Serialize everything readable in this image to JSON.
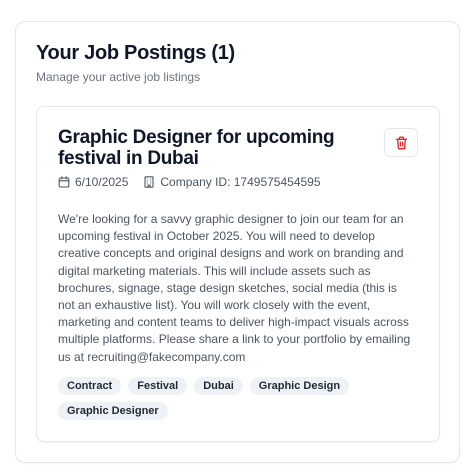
{
  "section": {
    "title": "Your Job Postings (1)",
    "subtitle": "Manage your active job listings"
  },
  "job": {
    "title": "Graphic Designer for upcoming festival in Dubai",
    "date": "6/10/2025",
    "company_id": "Company ID: 1749575454595",
    "description": "We're looking for a savvy graphic designer to join our team for an upcoming festival in October 2025. You will need to develop creative concepts and original designs and work on branding and digital marketing materials. This will include assets such as brochures, signage, stage design sketches, social media (this is not an exhaustive list). You will work closely with the event, marketing and content teams to deliver high-impact visuals across multiple platforms. Please share a link to your portfolio by emailing us at recruiting@fakecompany.com",
    "tags": [
      "Contract",
      "Festival",
      "Dubai",
      "Graphic Design",
      "Graphic Designer"
    ]
  },
  "icons": {
    "delete": "trash-icon",
    "date": "calendar-icon",
    "company": "building-icon"
  },
  "colors": {
    "delete_icon": "#dc2626",
    "tag_bg": "#eef2f7",
    "muted_text": "#6b7280"
  }
}
